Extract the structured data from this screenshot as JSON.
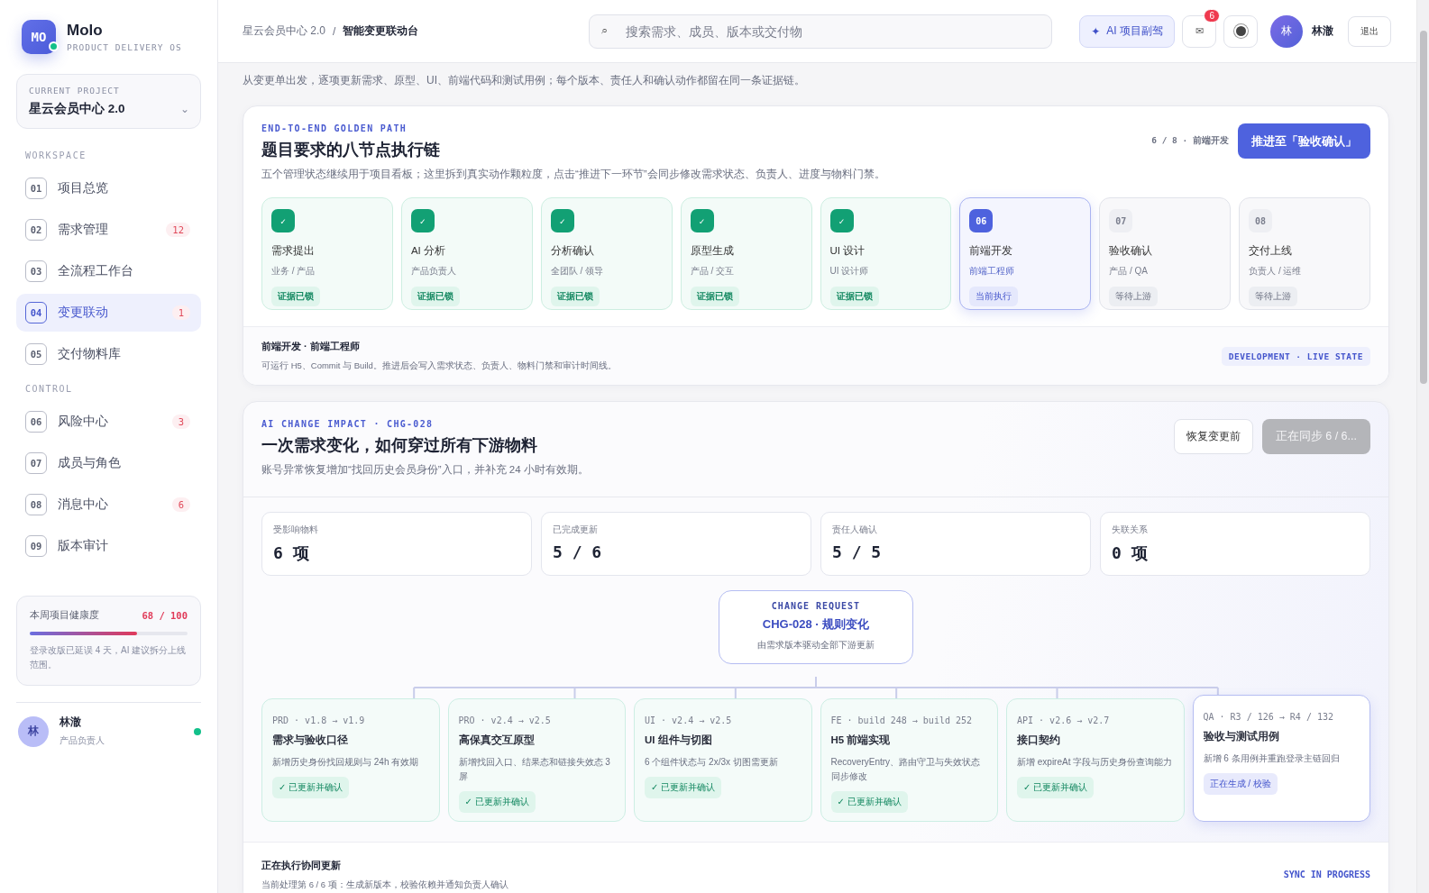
{
  "brand": {
    "logo": "MO",
    "name": "Molo",
    "tagline": "PRODUCT DELIVERY OS",
    "online": true
  },
  "project_picker": {
    "label": "CURRENT PROJECT",
    "value": "星云会员中心 2.0",
    "caret": "⌄"
  },
  "nav_sections": [
    {
      "title": "WORKSPACE",
      "items": [
        {
          "number": "01",
          "label": "项目总览",
          "selected": false
        },
        {
          "number": "02",
          "label": "需求管理",
          "badge": "12",
          "selected": false
        },
        {
          "number": "03",
          "label": "全流程工作台",
          "selected": false
        },
        {
          "number": "04",
          "label": "变更联动",
          "badge": "1",
          "selected": true
        },
        {
          "number": "05",
          "label": "交付物料库",
          "selected": false
        }
      ]
    },
    {
      "title": "CONTROL",
      "items": [
        {
          "number": "06",
          "label": "风险中心",
          "badge": "3",
          "selected": false
        },
        {
          "number": "07",
          "label": "成员与角色",
          "selected": false
        },
        {
          "number": "08",
          "label": "消息中心",
          "badge": "6",
          "selected": false
        },
        {
          "number": "09",
          "label": "版本审计",
          "selected": false
        }
      ]
    }
  ],
  "health": {
    "label": "本周项目健康度",
    "score": "68 / 100",
    "level": 0.68,
    "note": "登录改版已延误 4 天，AI 建议拆分上线范围。"
  },
  "user": {
    "avatar": "林",
    "name": "林澈",
    "role": "产品负责人",
    "online": true
  },
  "breadcrumb": {
    "items": [
      "星云会员中心 2.0",
      "智能变更联动台"
    ],
    "separator": "/"
  },
  "search": {
    "icon": "⌕",
    "placeholder": "搜索需求、成员、版本或交付物"
  },
  "header_actions": {
    "ai_button": {
      "icon": "✦",
      "label": "AI 项目副驾"
    },
    "messages": {
      "icon": "✉",
      "badge": "6"
    },
    "account": {
      "avatar": "林",
      "name": "林澈"
    },
    "logout": "退出"
  },
  "intro": "从变更单出发，逐项更新需求、原型、UI、前端代码和测试用例；每个版本、责任人和确认动作都留在同一条证据链。",
  "golden_path": {
    "eyebrow": "END-TO-END GOLDEN PATH",
    "title": "题目要求的八节点执行链",
    "description": "五个管理状态继续用于项目看板；这里拆到真实动作颗粒度，点击“推进下一环节”会同步修改需求状态、负责人、进度与物料门禁。",
    "progress": "6 / 8 · 前端开发",
    "advance_button": "推进至「验收确认」",
    "steps": [
      {
        "kind": "done",
        "marker": "✓",
        "title": "需求提出",
        "role": "业务 / 产品",
        "tag": "证据已锁"
      },
      {
        "kind": "done",
        "marker": "✓",
        "title": "AI 分析",
        "role": "产品负责人",
        "tag": "证据已锁"
      },
      {
        "kind": "done",
        "marker": "✓",
        "title": "分析确认",
        "role": "全团队 / 领导",
        "tag": "证据已锁"
      },
      {
        "kind": "done",
        "marker": "✓",
        "title": "原型生成",
        "role": "产品 / 交互",
        "tag": "证据已锁"
      },
      {
        "kind": "done",
        "marker": "✓",
        "title": "UI 设计",
        "role": "UI 设计师",
        "tag": "证据已锁"
      },
      {
        "kind": "current",
        "marker": "06",
        "title": "前端开发",
        "role": "前端工程师",
        "tag": "当前执行"
      },
      {
        "kind": "pending",
        "marker": "07",
        "title": "验收确认",
        "role": "产品 / QA",
        "tag": "等待上游"
      },
      {
        "kind": "pending",
        "marker": "08",
        "title": "交付上线",
        "role": "负责人 / 运维",
        "tag": "等待上游"
      }
    ],
    "footer": {
      "title": "前端开发 · 前端工程师",
      "text": "可运行 H5、Commit 与 Build。推进后会写入需求状态、负责人、物料门禁和审计时间线。",
      "tag": "DEVELOPMENT · LIVE STATE"
    }
  },
  "change_impact": {
    "eyebrow": "AI CHANGE IMPACT · CHG-028",
    "title": "一次需求变化，如何穿过所有下游物料",
    "description": "账号异常恢复增加“找回历史会员身份”入口，并补充 24 小时有效期。",
    "restore_button": "恢复变更前",
    "sync_button": {
      "label": "正在同步 6 / 6...",
      "disabled": true
    },
    "stats": [
      {
        "label": "受影响物料",
        "value": "6 项"
      },
      {
        "label": "已完成更新",
        "value": "5 / 6"
      },
      {
        "label": "责任人确认",
        "value": "5 / 5"
      },
      {
        "label": "失联关系",
        "value": "0 项"
      }
    ],
    "request": {
      "eyebrow": "CHANGE REQUEST",
      "title": "CHG-028 · 规则变化",
      "note": "由需求版本驱动全部下游更新"
    },
    "artifacts": [
      {
        "kind": "confirmed",
        "version": "PRD · v1.8 → v1.9",
        "title": "需求与验收口径",
        "description": "新增历史身份找回规则与 24h 有效期",
        "tag": "✓ 已更新并确认"
      },
      {
        "kind": "confirmed",
        "version": "PRO · v2.4 → v2.5",
        "title": "高保真交互原型",
        "description": "新增找回入口、结果态和链接失效态 3 屏",
        "tag": "✓ 已更新并确认"
      },
      {
        "kind": "confirmed",
        "version": "UI · v2.4 → v2.5",
        "title": "UI 组件与切图",
        "description": "6 个组件状态与 2x/3x 切图需更新",
        "tag": "✓ 已更新并确认"
      },
      {
        "kind": "confirmed",
        "version": "FE · build 248 → build 252",
        "title": "H5 前端实现",
        "description": "RecoveryEntry、路由守卫与失效状态同步修改",
        "tag": "✓ 已更新并确认"
      },
      {
        "kind": "confirmed",
        "version": "API · v2.6 → v2.7",
        "title": "接口契约",
        "description": "新增 expireAt 字段与历史身份查询能力",
        "tag": "✓ 已更新并确认"
      },
      {
        "kind": "generating",
        "version": "QA · R3 / 126 → R4 / 132",
        "title": "验收与测试用例",
        "description": "新增 6 条用例并重跑登录主链回归",
        "tag": "正在生成 / 校验"
      }
    ],
    "footer": {
      "title": "正在执行协同更新",
      "text": "当前处理第 6 / 6 项：生成新版本，校验依赖并通知负责人确认",
      "tag": "SYNC IN PROGRESS"
    }
  }
}
